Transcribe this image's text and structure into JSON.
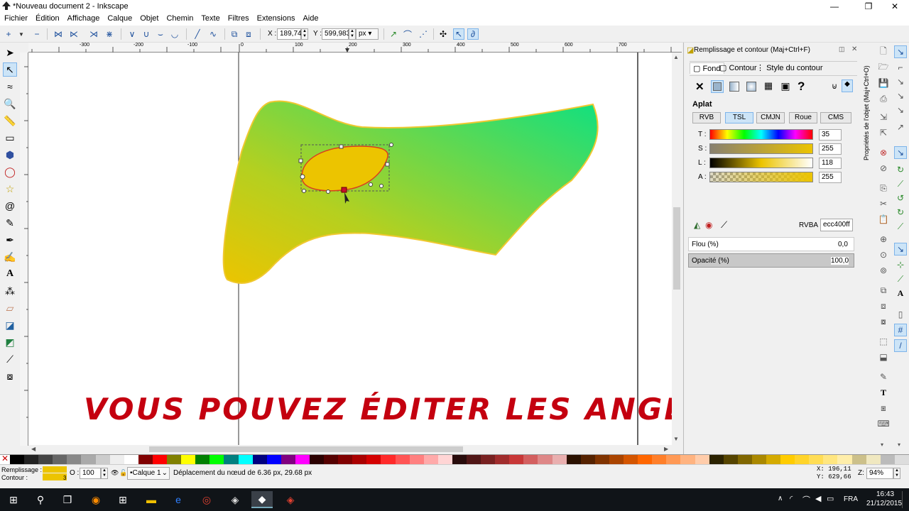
{
  "window": {
    "title": "*Nouveau document 2 - Inkscape",
    "buttons": [
      "—",
      "❐",
      "✕"
    ]
  },
  "menu": [
    "Fichier",
    "Édition",
    "Affichage",
    "Calque",
    "Objet",
    "Chemin",
    "Texte",
    "Filtres",
    "Extensions",
    "Aide"
  ],
  "toolbar": {
    "x_label": "X :",
    "x_value": "189,747",
    "y_label": "Y :",
    "y_value": "599,983",
    "unit": "px"
  },
  "ruler_labels": [
    "-300",
    "-200",
    "-100",
    "0",
    "100",
    "200",
    "300",
    "400",
    "500",
    "600",
    "700"
  ],
  "dock": {
    "title": "Remplissage et contour (Maj+Ctrl+F)",
    "tabs": [
      "Fond",
      "Contour",
      "Style du contour"
    ],
    "fill_mode": "Aplat",
    "color_tabs": [
      "RVB",
      "TSL",
      "CMJN",
      "Roue",
      "CMS"
    ],
    "active_color_tab": "TSL",
    "channels": [
      {
        "label": "T :",
        "value": "35"
      },
      {
        "label": "S :",
        "value": "255"
      },
      {
        "label": "L :",
        "value": "118"
      },
      {
        "label": "A :",
        "value": "255"
      }
    ],
    "rgba_label": "RVBA :",
    "rgba_value": "ecc400ff",
    "blur_label": "Flou (%)",
    "blur_value": "0,0",
    "opacity_label": "Opacité (%)",
    "opacity_value": "100,0",
    "side_label": "Propriétés de l'objet (Maj+Ctrl+O)"
  },
  "status": {
    "fill_label": "Remplissage :",
    "stroke_label": "Contour :",
    "stroke_width": "3",
    "opacity_label": "O :",
    "opacity_value": "100",
    "layer": "•Calque 1",
    "message": "Déplacement du nœud de 6.36 px, 29.68 px",
    "x_coord": "X:  196,11",
    "y_coord": "Y:  629,66",
    "zoom_label": "Z:",
    "zoom": "94%"
  },
  "taskbar": {
    "lang": "FRA",
    "time": "16:43",
    "date": "21/12/2015"
  },
  "overlay_text": "VOUS POUVEZ ÉDITER LES ANGLES",
  "colors": {
    "fill_shape_start": "#ecc400",
    "fill_shape_end": "#00e080",
    "ellipse": "#ecc400",
    "overlay": "#c4000f"
  }
}
